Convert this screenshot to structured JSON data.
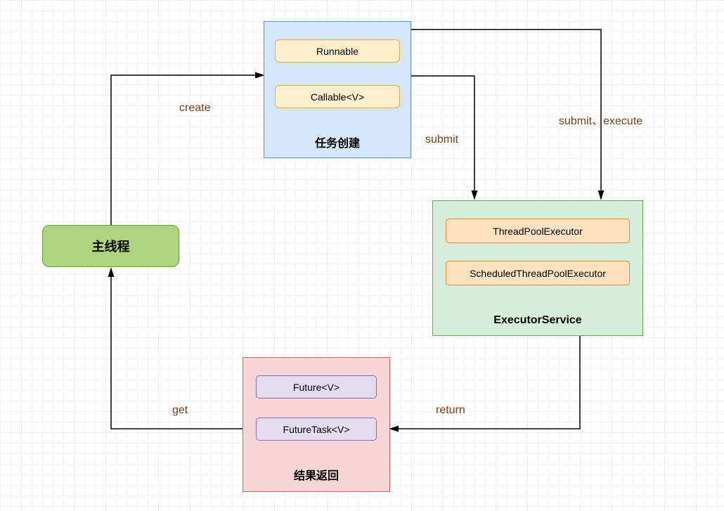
{
  "nodes": {
    "main_thread": {
      "label": "主线程"
    },
    "task_create": {
      "title": "任务创建",
      "items": [
        "Runnable",
        "Callable<V>"
      ]
    },
    "executor": {
      "title": "ExecutorService",
      "items": [
        "ThreadPoolExecutor",
        "ScheduledThreadPoolExecutor"
      ]
    },
    "result": {
      "title": "结果返回",
      "items": [
        "Future<V>",
        "FutureTask<V>"
      ]
    }
  },
  "edges": {
    "create": "create",
    "submit": "submit",
    "submit_execute": "submit、execute",
    "return": "return",
    "get": "get"
  },
  "colors": {
    "main_bg": "#aed47f",
    "task_bg": "#d4e6f7",
    "exec_bg": "#d7ecd9",
    "result_bg": "#f5d5d5",
    "label": "#7a3e1a"
  }
}
